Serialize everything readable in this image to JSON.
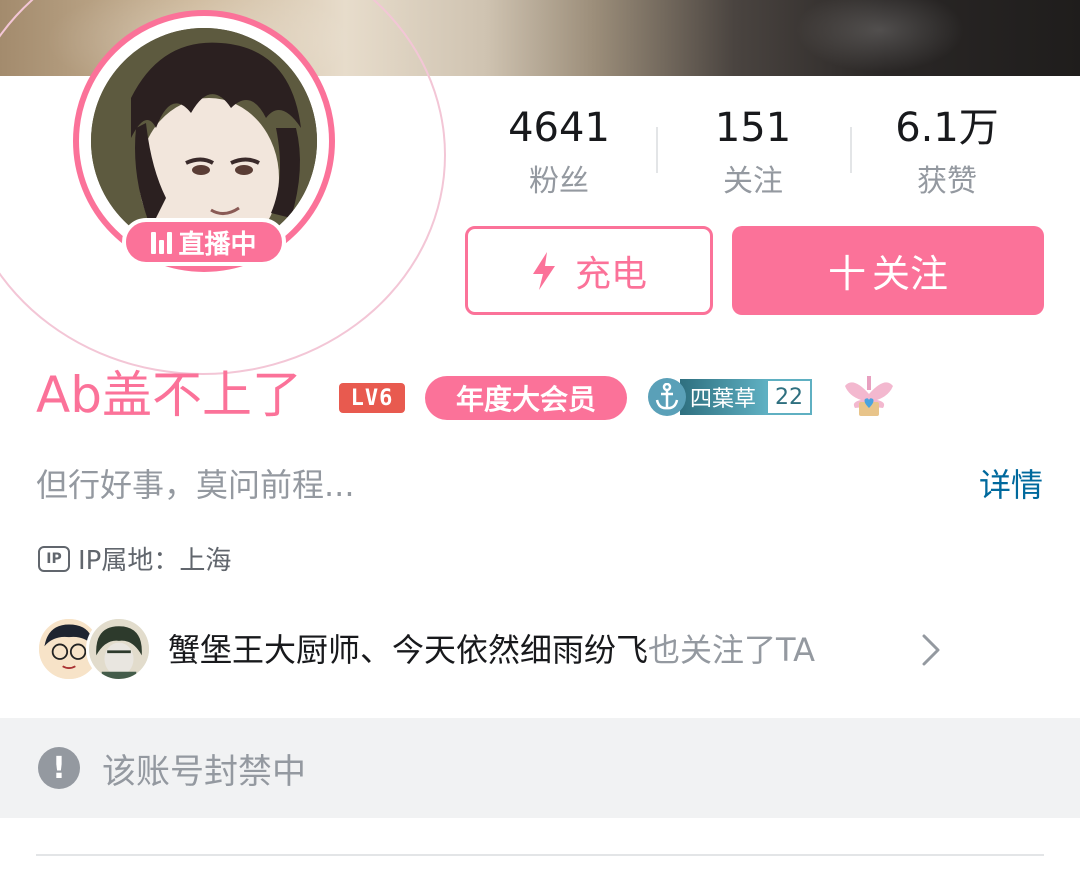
{
  "profile": {
    "name": "Ab盖不上了",
    "level": "LV6",
    "vip_label": "年度大会员",
    "live_label": "直播中",
    "medal": {
      "name": "四葉草",
      "level": "22"
    },
    "sign": "但行好事，莫问前程...",
    "detail_link": "详情",
    "ip_icon_text": "IP",
    "ip_location": "IP属地：上海"
  },
  "stats": [
    {
      "value": "4641",
      "label": "粉丝"
    },
    {
      "value": "151",
      "label": "关注"
    },
    {
      "value": "6.1万",
      "label": "获赞"
    }
  ],
  "actions": {
    "charge_label": "充电",
    "follow_label": "关注",
    "follow_plus": "十"
  },
  "mutual": {
    "names": "蟹堡王大厨师、今天依然细雨纷飞",
    "suffix": "也关注了TA"
  },
  "notice": {
    "text": "该账号封禁中",
    "icon": "!"
  },
  "icons": {
    "charge": "lightning-icon",
    "live": "live-bars-icon",
    "ip": "ip-icon",
    "chevron": "chevron-right-icon",
    "warning": "exclamation-icon",
    "medal": "anchor-icon",
    "badge": "winged-heart-icon"
  },
  "colors": {
    "accent": "#fb7299",
    "link": "#00699d",
    "level": "#e85a4f",
    "muted": "#9499a0"
  }
}
